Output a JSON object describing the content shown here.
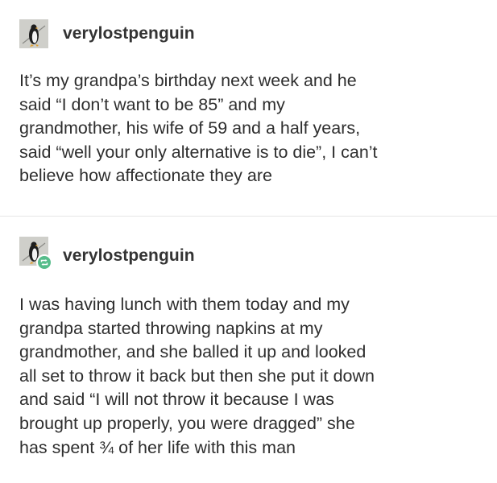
{
  "posts": [
    {
      "username": "verylostpenguin",
      "avatar_icon": "penguin-avatar-icon",
      "reblog": false,
      "text": "It’s my grandpa’s birthday next week and he\nsaid “I don’t want to be 85” and my\ngrandmother, his wife of 59 and a half years,\nsaid “well your only alternative is to die”, I can’t\nbelieve how affectionate they are"
    },
    {
      "username": "verylostpenguin",
      "avatar_icon": "penguin-avatar-icon",
      "reblog": true,
      "reblog_icon": "reblog-icon",
      "text": "I was having lunch with them today and my\ngrandpa started throwing napkins at my\ngrandmother, and she balled it up and looked\nall set to throw it back but then she put it down\nand said “I will not throw it because I was\nbrought up properly, you were dragged” she\nhas spent ¾ of her life with this man"
    }
  ],
  "colors": {
    "reblog_badge": "#56bc8a",
    "text": "#2e2e2e",
    "divider": "#e6e6e6"
  }
}
